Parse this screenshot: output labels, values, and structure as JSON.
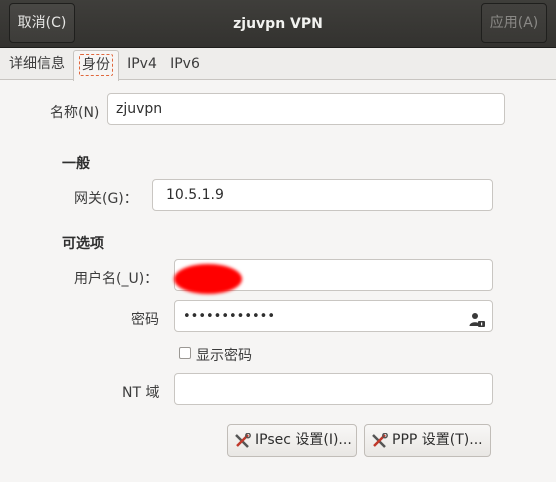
{
  "header": {
    "cancel_label": "取消(C)",
    "title": "zjuvpn VPN",
    "apply_label": "应用(A)"
  },
  "tabs": [
    "详细信息",
    "身份",
    "IPv4",
    "IPv6"
  ],
  "form": {
    "name_label": "名称(N)",
    "name_value": "zjuvpn",
    "general_heading": "一般",
    "gateway_label": "网关(G)：",
    "gateway_value": "10.5.1.9",
    "optional_heading": "可选项",
    "username_label": "用户名(_U)：",
    "username_value": "",
    "password_label": "密码",
    "password_value": "••••••••••••",
    "show_password_label": "显示密码",
    "show_password_checked": false,
    "nt_domain_label": "NT 域",
    "nt_domain_value": ""
  },
  "buttons": {
    "ipsec_label": "IPsec 设置(I)...",
    "ppp_label": "PPP 设置(T)..."
  },
  "icons": {
    "password_menu": "user-lock-icon",
    "ipsec_icon": "tools-icon",
    "ppp_icon": "tools-icon"
  }
}
